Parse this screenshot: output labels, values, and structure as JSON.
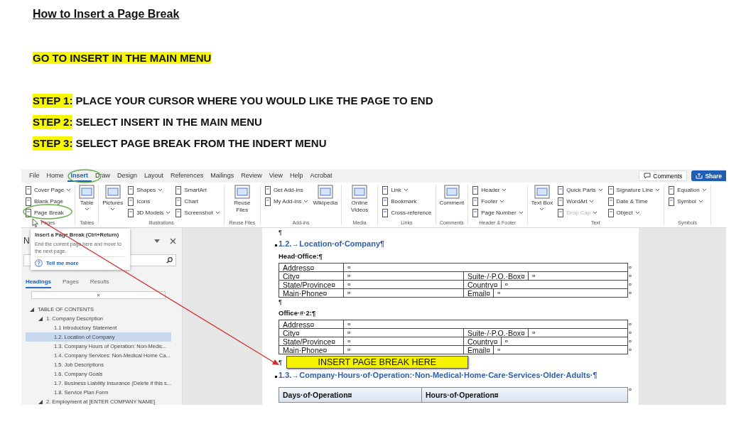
{
  "title": "How to Insert a Page Break",
  "instruction": "GO TO INSERT IN THE MAIN MENU",
  "steps": [
    {
      "label": "STEP 1:",
      "text": "PLACE YOUR CURSOR WHERE YOU WOULD LIKE THE PAGE TO END"
    },
    {
      "label": "STEP 2:",
      "text": "SELECT INSERT IN THE MAIN MENU"
    },
    {
      "label": "STEP 3:",
      "text": "SELECT PAGE BREAK FROM THE INDERT MENU"
    }
  ],
  "word_window": {
    "menu_tabs": [
      {
        "label": "File",
        "selected": false
      },
      {
        "label": "Home",
        "selected": false
      },
      {
        "label": "Insert",
        "selected": true
      },
      {
        "label": "Draw",
        "selected": false
      },
      {
        "label": "Design",
        "selected": false
      },
      {
        "label": "Layout",
        "selected": false
      },
      {
        "label": "References",
        "selected": false
      },
      {
        "label": "Mailings",
        "selected": false
      },
      {
        "label": "Review",
        "selected": false
      },
      {
        "label": "View",
        "selected": false
      },
      {
        "label": "Help",
        "selected": false
      },
      {
        "label": "Acrobat",
        "selected": false
      }
    ],
    "comments_button": "Comments",
    "share_button": "Share",
    "ribbon_groups": [
      {
        "name": "Pages",
        "columns": [
          [
            {
              "kind": "small",
              "label": "Cover Page",
              "dropdown": true
            },
            {
              "kind": "small",
              "label": "Blank Page",
              "dropdown": false
            },
            {
              "kind": "small",
              "label": "Page Break",
              "dropdown": false
            }
          ]
        ]
      },
      {
        "name": "Tables",
        "columns": [
          [
            {
              "kind": "large",
              "label": "Table",
              "dropdown": true
            }
          ]
        ]
      },
      {
        "name": "Illustrations",
        "columns": [
          [
            {
              "kind": "large",
              "label": "Pictures",
              "dropdown": true
            }
          ],
          [
            {
              "kind": "small",
              "label": "Shapes",
              "dropdown": true
            },
            {
              "kind": "small",
              "label": "Icons",
              "dropdown": false
            },
            {
              "kind": "small",
              "label": "3D Models",
              "dropdown": true
            }
          ],
          [
            {
              "kind": "small",
              "label": "SmartArt",
              "dropdown": false
            },
            {
              "kind": "small",
              "label": "Chart",
              "dropdown": false
            },
            {
              "kind": "small",
              "label": "Screenshot",
              "dropdown": true
            }
          ]
        ]
      },
      {
        "name": "Reuse Files",
        "columns": [
          [
            {
              "kind": "large",
              "label": "Reuse Files",
              "dropdown": false
            }
          ]
        ]
      },
      {
        "name": "Add-ins",
        "columns": [
          [
            {
              "kind": "small",
              "label": "Get Add-ins",
              "dropdown": false
            },
            {
              "kind": "small",
              "label": "My Add-ins",
              "dropdown": true
            }
          ],
          [
            {
              "kind": "large",
              "label": "Wikipedia",
              "dropdown": false
            }
          ]
        ]
      },
      {
        "name": "Media",
        "columns": [
          [
            {
              "kind": "large",
              "label": "Online Videos",
              "dropdown": false
            }
          ]
        ]
      },
      {
        "name": "Links",
        "columns": [
          [
            {
              "kind": "small",
              "label": "Link",
              "dropdown": true
            },
            {
              "kind": "small",
              "label": "Bookmark",
              "dropdown": false
            },
            {
              "kind": "small",
              "label": "Cross-reference",
              "dropdown": false
            }
          ]
        ]
      },
      {
        "name": "Comments",
        "columns": [
          [
            {
              "kind": "large",
              "label": "Comment",
              "dropdown": false
            }
          ]
        ]
      },
      {
        "name": "Header & Footer",
        "columns": [
          [
            {
              "kind": "small",
              "label": "Header",
              "dropdown": true
            },
            {
              "kind": "small",
              "label": "Footer",
              "dropdown": true
            },
            {
              "kind": "small",
              "label": "Page Number",
              "dropdown": true
            }
          ]
        ]
      },
      {
        "name": "Text",
        "columns": [
          [
            {
              "kind": "large",
              "label": "Text Box",
              "dropdown": true
            }
          ],
          [
            {
              "kind": "small",
              "label": "Quick Parts",
              "dropdown": true
            },
            {
              "kind": "small",
              "label": "WordArt",
              "dropdown": true
            },
            {
              "kind": "small",
              "label": "Drop Cap",
              "dropdown": true,
              "disabled": true
            }
          ],
          [
            {
              "kind": "small",
              "label": "Signature Line",
              "dropdown": true
            },
            {
              "kind": "small",
              "label": "Date & Time",
              "dropdown": false
            },
            {
              "kind": "small",
              "label": "Object",
              "dropdown": true
            }
          ]
        ]
      },
      {
        "name": "Symbols",
        "columns": [
          [
            {
              "kind": "small",
              "label": "Equation",
              "dropdown": true
            },
            {
              "kind": "small",
              "label": "Symbol",
              "dropdown": true
            }
          ]
        ]
      }
    ],
    "tooltip": {
      "title": "Insert a Page Break (Ctrl+Return)",
      "body": "End the current page here and move to the next page.",
      "link": "Tell me more"
    },
    "navigation": {
      "title": "N",
      "tabs": [
        {
          "label": "Headings",
          "selected": true
        },
        {
          "label": "Pages",
          "selected": false
        },
        {
          "label": "Results",
          "selected": false
        }
      ],
      "tree": [
        {
          "label": "TABLE OF CONTENTS",
          "expanded": true,
          "selected": false,
          "children": [
            {
              "label": "1. Company Description",
              "expanded": true,
              "selected": false,
              "children": [
                {
                  "label": "1.1 Introductory Statement",
                  "selected": false
                },
                {
                  "label": "1.2. Location of Company",
                  "selected": true
                },
                {
                  "label": "1.3. Company Hours of Operation: Non-Medic...",
                  "selected": false
                },
                {
                  "label": "1.4. Company Services: Non-Medical Home Ca...",
                  "selected": false
                },
                {
                  "label": "1.5. Job Descriptions",
                  "selected": false
                },
                {
                  "label": "1.6. Company Goals",
                  "selected": false
                },
                {
                  "label": "1.7. Business Liability Insurance (Delete if this s...",
                  "selected": false
                },
                {
                  "label": "1.8. Service Plan Form",
                  "selected": false
                }
              ]
            },
            {
              "label": "2. Employment at [ENTER COMPANY NAME]",
              "expanded": true,
              "selected": false
            }
          ]
        }
      ]
    },
    "document": [
      {
        "kind": "pilcrow",
        "text": "¶"
      },
      {
        "kind": "heading",
        "text": "1.2.→Location·of·Company¶"
      },
      {
        "kind": "label",
        "text": "Head·Office:¶"
      },
      {
        "kind": "table",
        "rows": [
          {
            "cells": [
              "Address¤",
              "¤"
            ],
            "end": "¤"
          },
          {
            "cells": [
              "City¤",
              "¤",
              "Suite·/·P.O.·Box¤",
              "¤"
            ],
            "end": "¤"
          },
          {
            "cells": [
              "State/Province¤",
              "¤",
              "Country¤",
              "¤"
            ],
            "end": "¤"
          },
          {
            "cells": [
              "Main·Phone¤",
              "¤",
              "Email¤",
              "¤"
            ],
            "end": "¤"
          }
        ]
      },
      {
        "kind": "pilcrow",
        "text": "¶"
      },
      {
        "kind": "label",
        "text": "Office·#·2:¶"
      },
      {
        "kind": "table",
        "rows": [
          {
            "cells": [
              "Address¤",
              "¤"
            ],
            "end": "¤"
          },
          {
            "cells": [
              "City¤",
              "¤",
              "Suite·/·P.O.·Box¤",
              "¤"
            ],
            "end": "¤"
          },
          {
            "cells": [
              "State/Province¤",
              "¤",
              "Country¤",
              "¤"
            ],
            "end": "¤"
          },
          {
            "cells": [
              "Main·Phone¤",
              "¤",
              "Email¤",
              "¤"
            ],
            "end": "¤"
          }
        ]
      },
      {
        "kind": "callout",
        "mark": "¶",
        "text": "INSERT PAGE BREAK HERE"
      },
      {
        "kind": "heading",
        "text": "1.3.→Company·Hours·of·Operation:·Non-Medical·Home·Care·Services·Older·Adults·¶"
      },
      {
        "kind": "header_table",
        "cells": [
          "Days·of·Operation¤",
          "Hours·of·Operation¤"
        ],
        "end": "¤"
      }
    ]
  }
}
